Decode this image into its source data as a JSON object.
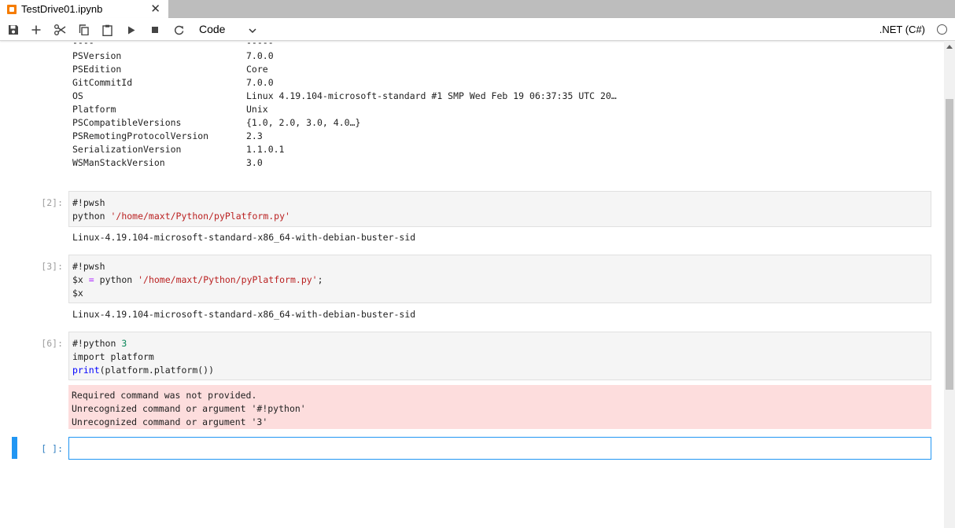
{
  "tab": {
    "title": "TestDrive01.ipynb",
    "close_glyph": "✕",
    "icon": "notebook-icon"
  },
  "toolbar": {
    "buttons": [
      "save-icon",
      "add-icon",
      "cut-icon",
      "copy-icon",
      "paste-icon",
      "run-icon",
      "stop-icon",
      "restart-icon"
    ],
    "cell_type": "Code",
    "kernel_name": ".NET (C#)"
  },
  "version_table": {
    "top_dashes_key": "----",
    "top_dashes_val": "-----",
    "rows": [
      {
        "key": "PSVersion",
        "value": "7.0.0"
      },
      {
        "key": "PSEdition",
        "value": "Core"
      },
      {
        "key": "GitCommitId",
        "value": "7.0.0"
      },
      {
        "key": "OS",
        "value": "Linux 4.19.104-microsoft-standard #1 SMP Wed Feb 19 06:37:35 UTC 20…"
      },
      {
        "key": "Platform",
        "value": "Unix"
      },
      {
        "key": "PSCompatibleVersions",
        "value": "{1.0, 2.0, 3.0, 4.0…}"
      },
      {
        "key": "PSRemotingProtocolVersion",
        "value": "2.3"
      },
      {
        "key": "SerializationVersion",
        "value": "1.1.0.1"
      },
      {
        "key": "WSManStackVersion",
        "value": "3.0"
      }
    ]
  },
  "cells": [
    {
      "prompt": "[2]:",
      "lines": [
        {
          "a": "#!pwsh"
        },
        {
          "a": "python ",
          "s": "'/home/maxt/Python/pyPlatform.py'"
        }
      ],
      "output": "Linux-4.19.104-microsoft-standard-x86_64-with-debian-buster-sid"
    },
    {
      "prompt": "[3]:",
      "lines": [
        {
          "a": "#!pwsh"
        },
        {
          "a": "$x ",
          "op": "=",
          "b": " python ",
          "s": "'/home/maxt/Python/pyPlatform.py'",
          "c": ";"
        },
        {
          "a": "$x"
        }
      ],
      "output": "Linux-4.19.104-microsoft-standard-x86_64-with-debian-buster-sid"
    },
    {
      "prompt": "[6]:",
      "lines": [
        {
          "a": "#!python ",
          "n": "3"
        },
        {
          "a": "import platform"
        },
        {
          "kw": "print",
          "a": "(platform.platform())"
        }
      ],
      "error": [
        "Required command was not provided.",
        "Unrecognized command or argument '#!python'",
        "Unrecognized command or argument '3'"
      ]
    }
  ],
  "active_cell": {
    "prompt": "[ ]:"
  }
}
